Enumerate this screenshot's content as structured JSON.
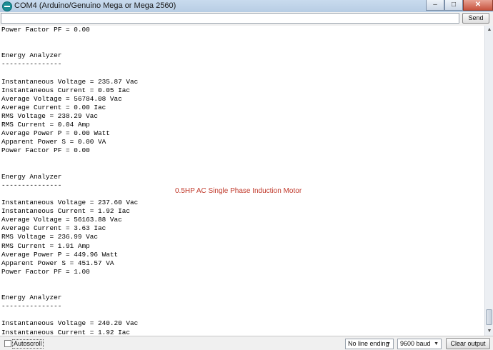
{
  "window": {
    "title": "COM4 (Arduino/Genuino Mega or Mega 2560)",
    "minimize": "–",
    "maximize": "□",
    "close": "✕"
  },
  "input": {
    "value": "",
    "send_label": "Send"
  },
  "output": {
    "lines": [
      "Power Factor PF = 0.00",
      "",
      "",
      "Energy Analyzer",
      "---------------",
      "",
      "Instantaneous Voltage = 235.87 Vac",
      "Instantaneous Current = 0.05 Iac",
      "Average Voltage = 56784.08 Vac",
      "Average Current = 0.00 Iac",
      "RMS Voltage = 238.29 Vac",
      "RMS Current = 0.04 Amp",
      "Average Power P = 0.00 Watt",
      "Apparent Power S = 0.00 VA",
      "Power Factor PF = 0.00",
      "",
      "",
      "Energy Analyzer",
      "---------------",
      "",
      "Instantaneous Voltage = 237.60 Vac",
      "Instantaneous Current = 1.92 Iac",
      "Average Voltage = 56163.88 Vac",
      "Average Current = 3.63 Iac",
      "RMS Voltage = 236.99 Vac",
      "RMS Current = 1.91 Amp",
      "Average Power P = 449.96 Watt",
      "Apparent Power S = 451.57 VA",
      "Power Factor PF = 1.00",
      "",
      "",
      "Energy Analyzer",
      "---------------",
      "",
      "Instantaneous Voltage = 240.20 Vac",
      "Instantaneous Current = 1.92 Iac"
    ],
    "annotation": "0.5HP AC Single Phase Induction Motor"
  },
  "bottom": {
    "autoscroll_label": "Autoscroll",
    "autoscroll_checked": false,
    "line_ending": "No line ending",
    "baud": "9600 baud",
    "clear_label": "Clear output"
  }
}
